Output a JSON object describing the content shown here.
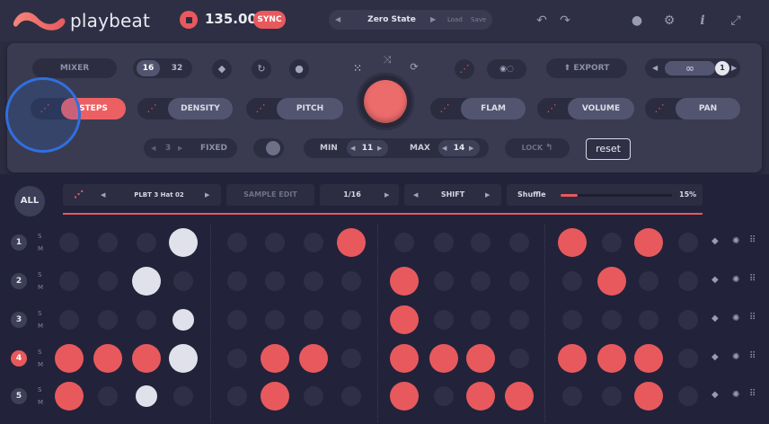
{
  "app": {
    "brand": "playbeat",
    "brand_color": "#e8595d"
  },
  "transport": {
    "bpm": "135.00",
    "sync_label": "SYNC"
  },
  "preset": {
    "name": "Zero State",
    "load_label": "Load",
    "save_label": "Save",
    "prev": "◀",
    "next": "▶"
  },
  "top_icons": [
    "undo-icon",
    "redo-icon",
    "mood-icon",
    "settings-icon",
    "info-icon",
    "expand-icon"
  ],
  "panel": {
    "mixer_label": "MIXER",
    "steps_a": "16",
    "steps_b": "32",
    "export_label": "EXPORT",
    "loop_count": "1",
    "params": [
      {
        "id": "steps",
        "label": "STEPS",
        "active": true
      },
      {
        "id": "density",
        "label": "DENSITY",
        "active": false
      },
      {
        "id": "pitch",
        "label": "PITCH",
        "active": false
      },
      {
        "id": "flam",
        "label": "FLAM",
        "active": false
      },
      {
        "id": "volume",
        "label": "VOLUME",
        "active": false
      },
      {
        "id": "pan",
        "label": "PAN",
        "active": false
      }
    ],
    "fixed_value": "3",
    "fixed_label": "FIXED",
    "min_label": "MIN",
    "min_value": "11",
    "max_label": "MAX",
    "max_value": "14",
    "lock_label": "LOCK",
    "reset_label": "reset"
  },
  "sequencer": {
    "all_label": "ALL",
    "sample_name": "PLBT 3  Hat 02",
    "sample_edit_label": "SAMPLE EDIT",
    "division": "1/16",
    "shift_label": "SHIFT",
    "shuffle_label": "Shuffle",
    "shuffle_value": "15%",
    "shuffle_level": 0.15,
    "solo_label": "S",
    "mute_label": "M",
    "rows": [
      {
        "num": "1",
        "selected": false,
        "steps": [
          "o",
          "o",
          "o",
          "W",
          "o",
          "o",
          "o",
          "R",
          "o",
          "o",
          "o",
          "o",
          "R",
          "o",
          "R",
          "o"
        ]
      },
      {
        "num": "2",
        "selected": false,
        "steps": [
          "o",
          "o",
          "W",
          "o",
          "o",
          "o",
          "o",
          "o",
          "R",
          "o",
          "o",
          "o",
          "o",
          "R",
          "o",
          "o"
        ]
      },
      {
        "num": "3",
        "selected": false,
        "steps": [
          "o",
          "o",
          "o",
          "w",
          "o",
          "o",
          "o",
          "o",
          "R",
          "o",
          "o",
          "o",
          "o",
          "o",
          "o",
          "o"
        ]
      },
      {
        "num": "4",
        "selected": true,
        "steps": [
          "R",
          "R",
          "R",
          "W",
          "o",
          "R",
          "R",
          "o",
          "R",
          "R",
          "R",
          "o",
          "R",
          "R",
          "R",
          "o"
        ]
      },
      {
        "num": "5",
        "selected": false,
        "steps": [
          "R",
          "o",
          "w",
          "o",
          "o",
          "R",
          "o",
          "o",
          "R",
          "o",
          "R",
          "R",
          "o",
          "o",
          "R",
          "o"
        ]
      }
    ]
  }
}
